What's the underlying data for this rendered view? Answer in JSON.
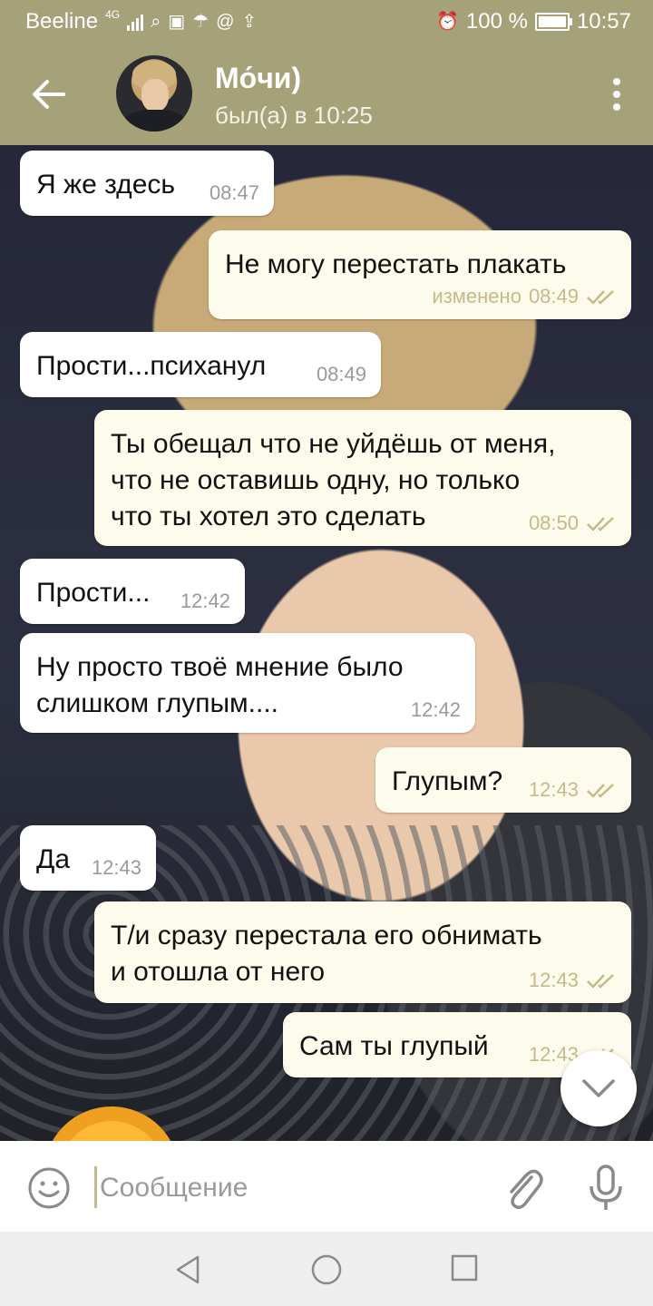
{
  "status_bar": {
    "carrier": "Beeline",
    "network": "4G",
    "battery": "100 %",
    "time": "10:57"
  },
  "header": {
    "name": "Мо́чи)",
    "status": "был(а) в 10:25"
  },
  "messages": [
    {
      "dir": "in",
      "text": "Я же здесь",
      "time": "08:47"
    },
    {
      "dir": "out",
      "text": "Не могу перестать плакать",
      "time": "08:49",
      "edited": "изменено"
    },
    {
      "dir": "in",
      "text": "Прости...психанул",
      "time": "08:49"
    },
    {
      "dir": "out",
      "text": "Ты обещал что не уйдёшь от меня,\nчто не оставишь одну, но только\nчто ты хотел это сделать",
      "time": "08:50"
    },
    {
      "dir": "in",
      "text": "Прости...",
      "time": "12:42"
    },
    {
      "dir": "in",
      "text": "Ну просто твоё мнение было\nслишком глупым....",
      "time": "12:42"
    },
    {
      "dir": "out",
      "text": "Глупым?",
      "time": "12:43"
    },
    {
      "dir": "in",
      "text": "Да",
      "time": "12:43"
    },
    {
      "dir": "out",
      "text": "Т/и сразу перестала его обнимать\nи отошла от него",
      "time": "12:43"
    },
    {
      "dir": "out",
      "text": "Сам ты глупый",
      "time": "12:43"
    }
  ],
  "input": {
    "placeholder": "Сообщение"
  },
  "colors": {
    "header": "#a5a27a",
    "incoming_bubble": "#ffffff",
    "outgoing_bubble": "#fdfbec",
    "tick": "#c5b98c"
  }
}
